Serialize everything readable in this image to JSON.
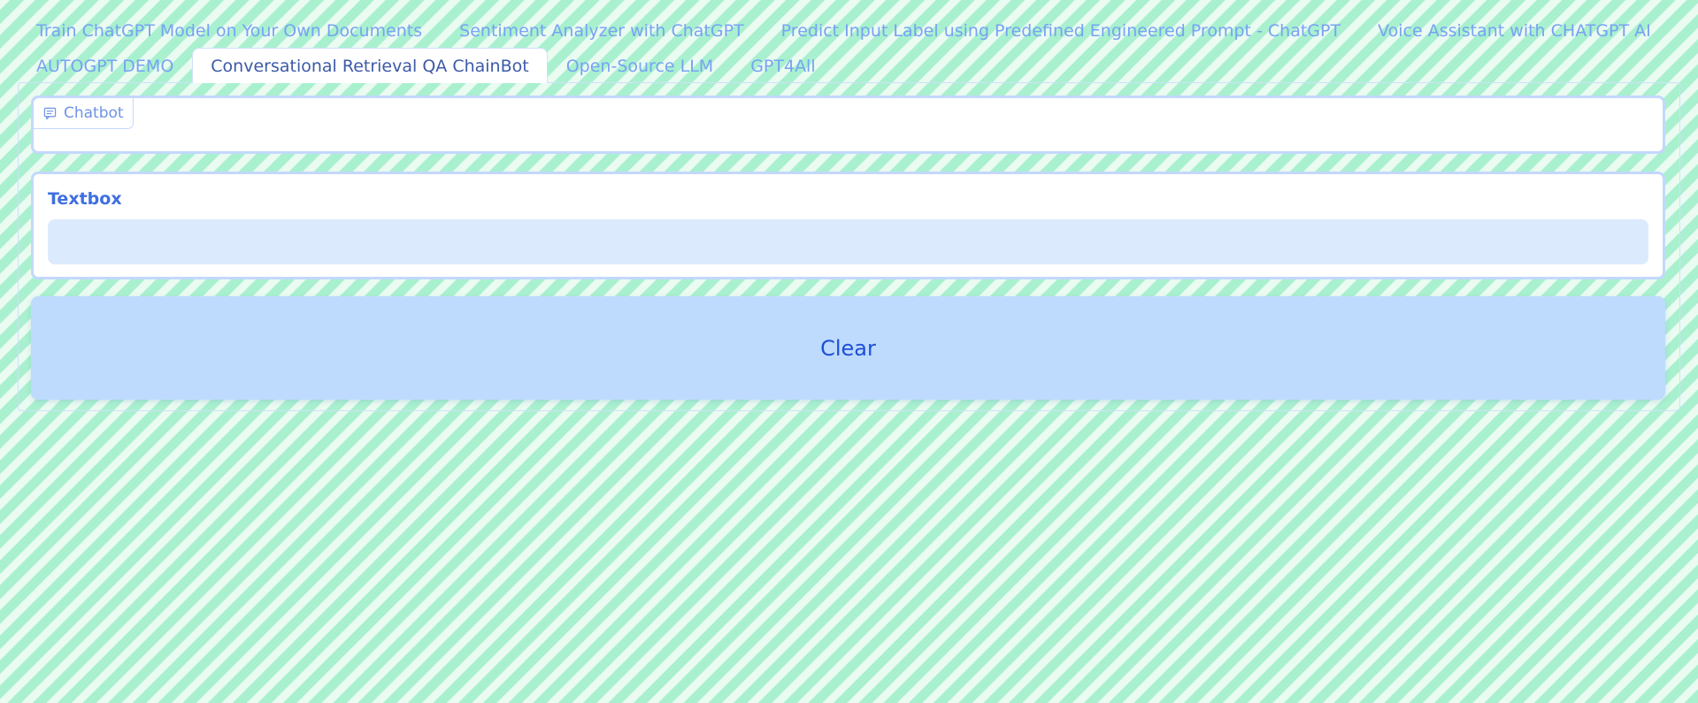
{
  "tabs": [
    {
      "label": "Train ChatGPT Model on Your Own Documents",
      "active": false
    },
    {
      "label": "Sentiment Analyzer with ChatGPT",
      "active": false
    },
    {
      "label": "Predict Input Label using Predefined Engineered Prompt - ChatGPT",
      "active": false
    },
    {
      "label": "Voice Assistant with CHATGPT AI",
      "active": false
    },
    {
      "label": "AUTOGPT DEMO",
      "active": false
    },
    {
      "label": "Conversational Retrieval QA ChainBot",
      "active": true
    },
    {
      "label": "Open-Source LLM",
      "active": false
    },
    {
      "label": "GPT4All",
      "active": false
    }
  ],
  "chatbot": {
    "label": "Chatbot",
    "icon": "chat-icon"
  },
  "textbox": {
    "label": "Textbox",
    "value": ""
  },
  "clear_button": {
    "label": "Clear"
  },
  "colors": {
    "tab_text": "#76a3f3",
    "active_tab_text": "#3d5aa8",
    "label_text": "#3f6fe0",
    "input_bg": "#dceafd",
    "button_bg": "#bedbfe",
    "button_text": "#1d4ed8",
    "stripe_green": "#a9f0cf"
  }
}
